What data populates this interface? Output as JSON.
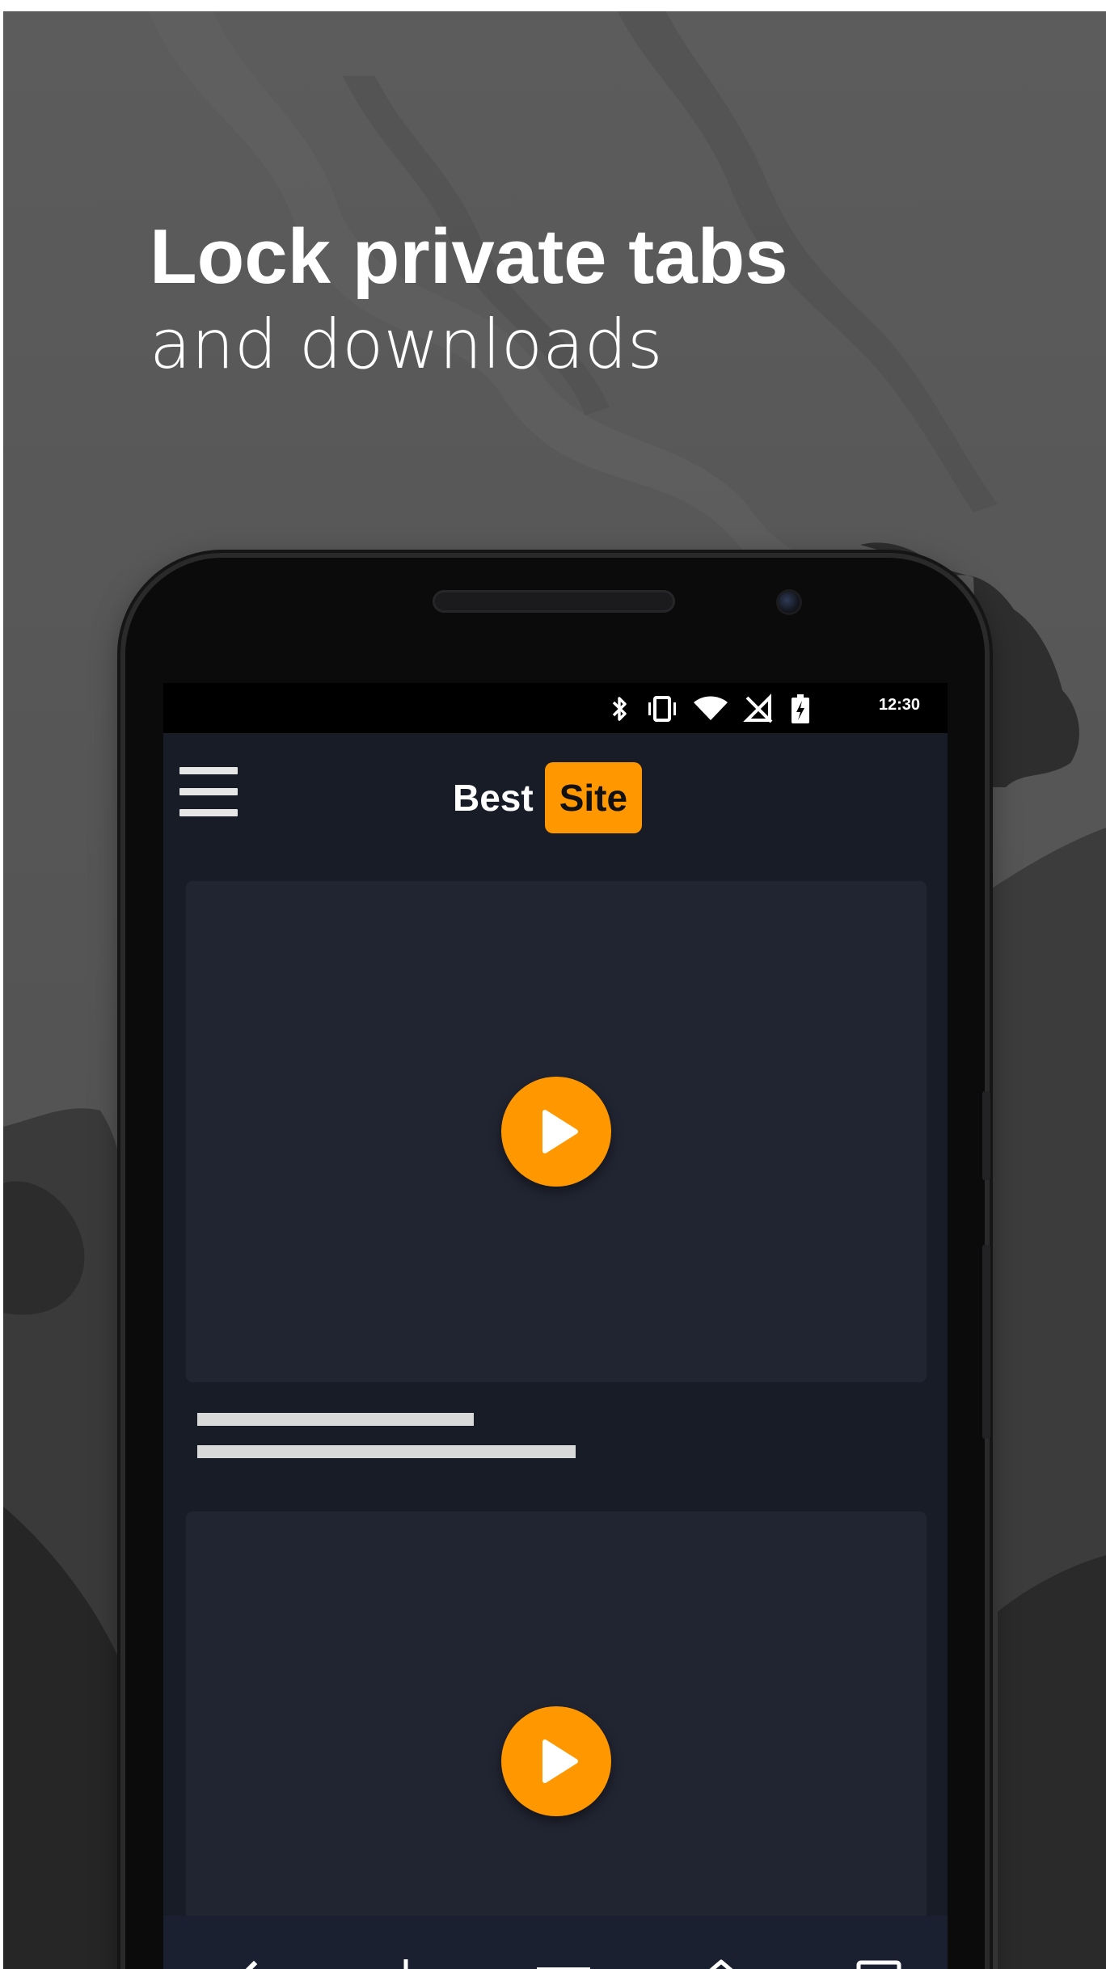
{
  "promo": {
    "headline_line1": "Lock private tabs",
    "headline_line2": "and downloads"
  },
  "status_bar": {
    "time": "12:30",
    "icons": [
      "bluetooth-icon",
      "vibrate-icon",
      "wifi-icon",
      "no-signal-icon",
      "battery-charging-icon"
    ]
  },
  "header": {
    "logo_part1": "Best",
    "logo_part2": "Site",
    "accent_color": "#ff9800"
  },
  "content": {
    "cards": [
      {
        "type": "video-placeholder",
        "icon": "play-icon"
      },
      {
        "type": "video-placeholder",
        "icon": "play-icon"
      }
    ]
  },
  "bottom_nav": {
    "items": [
      "back-icon",
      "download-icon",
      "menu-icon",
      "home-icon",
      "tabs-icon"
    ]
  },
  "colors": {
    "background": "#565656",
    "screen_background": "#181c27",
    "card_background": "#212532",
    "accent": "#ff9800"
  }
}
